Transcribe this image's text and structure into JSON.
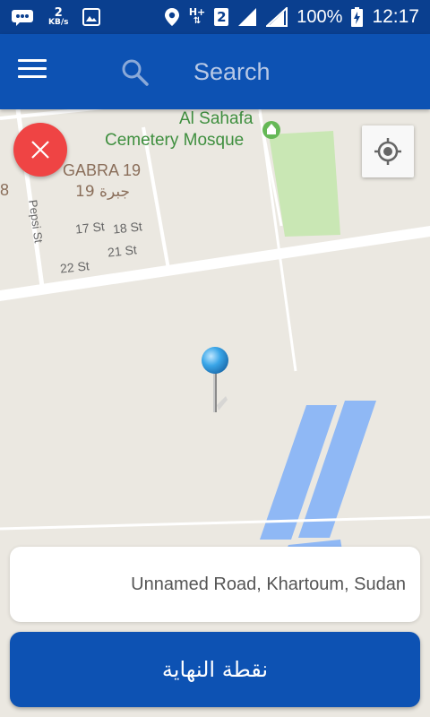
{
  "status_bar": {
    "net_speed_value": "2",
    "net_speed_unit": "KB/s",
    "network_type": "H+",
    "sim_slot": "2",
    "battery_percent": "100%",
    "time": "12:17"
  },
  "app_bar": {
    "search_placeholder": "Search"
  },
  "map": {
    "labels": {
      "mosque_line1": "Al Sahafa",
      "mosque_line2": "Cemetery Mosque",
      "area_en": "GABRA 19",
      "area_ar": "جبرة 19",
      "street_pepsi": "Pepsi St",
      "street_17": "17 St",
      "street_18": "18 St",
      "street_21": "21 St",
      "street_22": "22 St",
      "edge_digit": "8"
    },
    "colors": {
      "land": "#ebe8e1",
      "park": "#c9e7b4",
      "water": "#8fb8f5",
      "road": "#ffffff"
    }
  },
  "address": {
    "text": "Unnamed Road, Khartoum, Sudan"
  },
  "actions": {
    "endpoint_label": "نقطة النهاية"
  },
  "colors": {
    "status_bar": "#0a3f8f",
    "app_bar": "#0d52b3",
    "close_button": "#ef4444",
    "pin_head": "#3aa6e8"
  }
}
